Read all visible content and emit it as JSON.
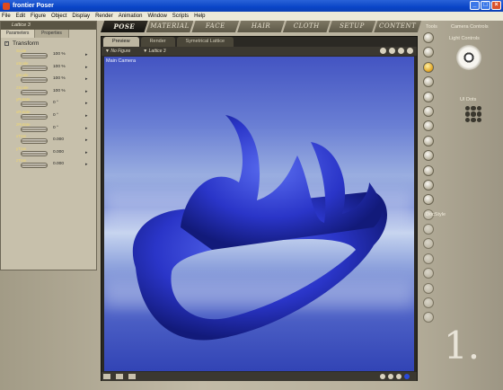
{
  "window": {
    "title": "frontier Poser"
  },
  "menu": [
    "File",
    "Edit",
    "Figure",
    "Object",
    "Display",
    "Render",
    "Animation",
    "Window",
    "Scripts",
    "Help"
  ],
  "rooms": [
    "POSE",
    "MATERIAL",
    "FACE",
    "HAIR",
    "CLOTH",
    "SETUP",
    "CONTENT"
  ],
  "params": {
    "title": "Lattice 3",
    "tabs": [
      "Parameters",
      "Properties"
    ],
    "group": "Transform",
    "items": [
      {
        "label": "Scale",
        "value": "100 %"
      },
      {
        "label": "xScale",
        "value": "100 %"
      },
      {
        "label": "yScale",
        "value": "100 %"
      },
      {
        "label": "zScale",
        "value": "100 %"
      },
      {
        "label": "yRotate",
        "value": "0 °"
      },
      {
        "label": "xRotate",
        "value": "0 °"
      },
      {
        "label": "zRotate",
        "value": "0 °"
      },
      {
        "label": "xTran",
        "value": "0.000"
      },
      {
        "label": "yTran",
        "value": "0.000"
      },
      {
        "label": "zTran",
        "value": "0.000"
      }
    ]
  },
  "doc": {
    "tabs": [
      "Preview",
      "Render",
      "Symetrical Lattice"
    ],
    "figure_select": "No Figure",
    "actor_select": "Lattice 3",
    "camera_label": "Main Camera"
  },
  "side": {
    "tools_label": "Tools",
    "camera_controls": "Camera Controls",
    "light_controls": "Light Controls",
    "ui_dots": "UI Dots",
    "doc_style": "DocStyle",
    "big_number": "1."
  },
  "colors": {
    "model": "#2a35c8",
    "sky": "#6a7fd4"
  }
}
